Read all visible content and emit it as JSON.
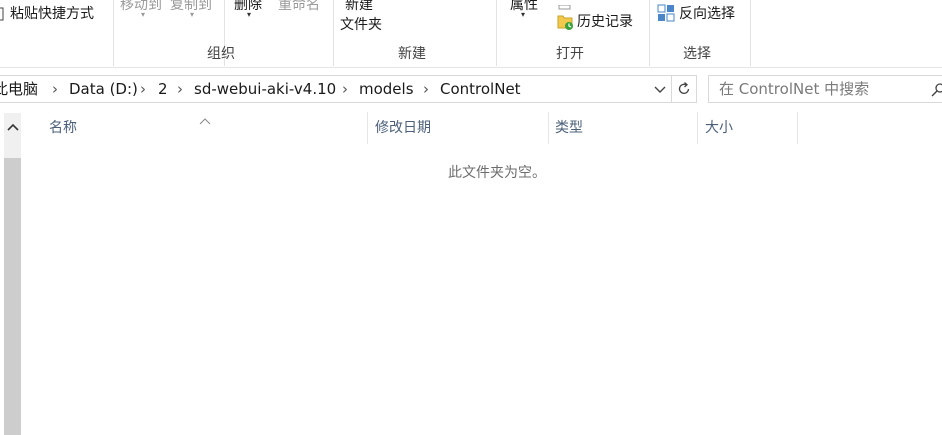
{
  "ribbon": {
    "paste_shortcut": "粘贴快捷方式",
    "move_to": "移动到",
    "copy_to": "复制到",
    "delete": "删除",
    "rename": "重命名",
    "new_folder_line1": "新建",
    "new_folder_line2": "文件夹",
    "properties": "属性",
    "history": "历史记录",
    "invert_selection": "反向选择",
    "groups": {
      "organize": "组织",
      "new": "新建",
      "open": "打开",
      "select": "选择"
    }
  },
  "address": {
    "crumbs": [
      "此电脑",
      "Data (D:)",
      "2",
      "sd-webui-aki-v4.10",
      "models",
      "ControlNet"
    ]
  },
  "search": {
    "placeholder": "在 ControlNet 中搜索"
  },
  "columns": {
    "name": "名称",
    "modified": "修改日期",
    "type": "类型",
    "size": "大小"
  },
  "empty_message": "此文件夹为空。",
  "colors": {
    "column_header": "#4c607a",
    "scrollbar_thumb": "#cdcdcd"
  }
}
